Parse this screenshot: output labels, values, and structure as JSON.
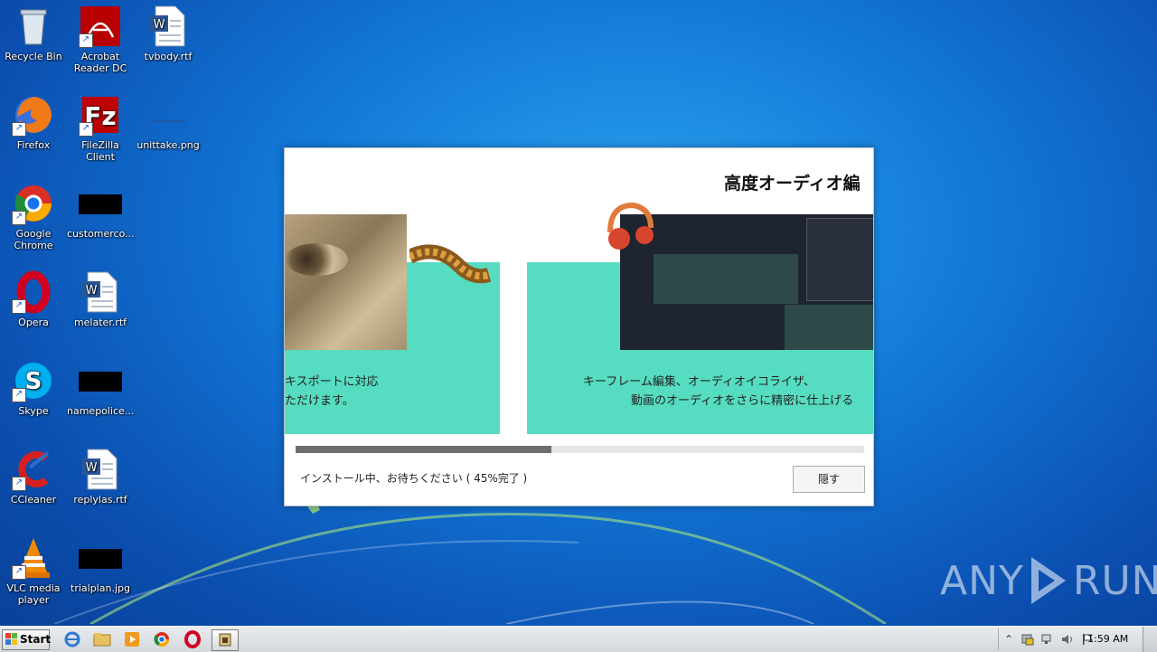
{
  "desktop": {
    "icons": [
      {
        "label": "Recycle Bin",
        "icon": "recycle-bin-icon",
        "shortcut": false
      },
      {
        "label": "Acrobat Reader DC",
        "icon": "acrobat-icon",
        "shortcut": true
      },
      {
        "label": "tvbody.rtf",
        "icon": "word-doc-icon",
        "shortcut": false
      },
      {
        "label": "Firefox",
        "icon": "firefox-icon",
        "shortcut": true
      },
      {
        "label": "FileZilla Client",
        "icon": "filezilla-icon",
        "shortcut": true
      },
      {
        "label": "unittake.png",
        "icon": "image-file-icon",
        "shortcut": false
      },
      {
        "label": "Google Chrome",
        "icon": "chrome-icon",
        "shortcut": true
      },
      {
        "label": "customerco...",
        "icon": "black-file-icon",
        "shortcut": false
      },
      {
        "label": "Opera",
        "icon": "opera-icon",
        "shortcut": true
      },
      {
        "label": "melater.rtf",
        "icon": "word-doc-icon",
        "shortcut": false
      },
      {
        "label": "Skype",
        "icon": "skype-icon",
        "shortcut": true
      },
      {
        "label": "namepolice...",
        "icon": "black-file-icon",
        "shortcut": false
      },
      {
        "label": "CCleaner",
        "icon": "ccleaner-icon",
        "shortcut": true
      },
      {
        "label": "replylas.rtf",
        "icon": "word-doc-icon",
        "shortcut": false
      },
      {
        "label": "VLC media player",
        "icon": "vlc-icon",
        "shortcut": true
      },
      {
        "label": "trialplan.jpg",
        "icon": "black-file-icon",
        "shortcut": false
      }
    ]
  },
  "installer": {
    "slide_title": "高度オーディオ編",
    "left_caption_line1": "キスポートに対応",
    "left_caption_line2": "ただけます。",
    "right_caption_line1": "キーフレーム編集、オーディオイコライザ、",
    "right_caption_line2": "動画のオーディオをさらに精密に仕上げる",
    "progress_fraction": 0.45,
    "status_text": "インストール中、お待ちください ( 45%完了 )",
    "hide_button": "隠す"
  },
  "watermark": {
    "left": "ANY",
    "right": "RUN"
  },
  "taskbar": {
    "start_label": "Start",
    "pinned": [
      "internet-explorer-icon",
      "explorer-folder-icon",
      "media-player-icon",
      "chrome-icon",
      "opera-icon",
      "installer-app-icon"
    ],
    "clock": "1:59 AM"
  }
}
